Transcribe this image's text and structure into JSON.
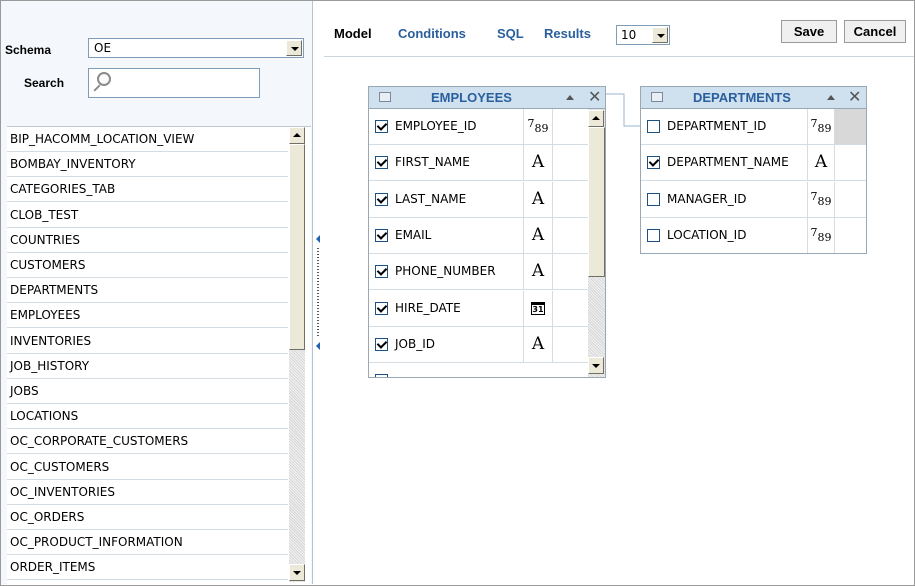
{
  "left_panel": {
    "schema_label": "Schema",
    "schema_value": "OE",
    "search_label": "Search",
    "tables": [
      "BIP_HACOMM_LOCATION_VIEW",
      "BOMBAY_INVENTORY",
      "CATEGORIES_TAB",
      "CLOB_TEST",
      "COUNTRIES",
      "CUSTOMERS",
      "DEPARTMENTS",
      "EMPLOYEES",
      "INVENTORIES",
      "JOB_HISTORY",
      "JOBS",
      "LOCATIONS",
      "OC_CORPORATE_CUSTOMERS",
      "OC_CUSTOMERS",
      "OC_INVENTORIES",
      "OC_ORDERS",
      "OC_PRODUCT_INFORMATION",
      "ORDER_ITEMS"
    ]
  },
  "toolbar": {
    "tabs": [
      "Model",
      "Conditions",
      "SQL",
      "Results"
    ],
    "rows_value": "10",
    "save_label": "Save",
    "cancel_label": "Cancel"
  },
  "employees": {
    "title": "EMPLOYEES",
    "columns": [
      {
        "name": "EMPLOYEE_ID",
        "type": "number",
        "checked": true
      },
      {
        "name": "FIRST_NAME",
        "type": "text",
        "checked": true
      },
      {
        "name": "LAST_NAME",
        "type": "text",
        "checked": true
      },
      {
        "name": "EMAIL",
        "type": "text",
        "checked": true
      },
      {
        "name": "PHONE_NUMBER",
        "type": "text",
        "checked": true
      },
      {
        "name": "HIRE_DATE",
        "type": "date",
        "checked": true
      },
      {
        "name": "JOB_ID",
        "type": "text",
        "checked": true
      }
    ]
  },
  "departments": {
    "title": "DEPARTMENTS",
    "columns": [
      {
        "name": "DEPARTMENT_ID",
        "type": "number",
        "checked": false
      },
      {
        "name": "DEPARTMENT_NAME",
        "type": "text",
        "checked": true
      },
      {
        "name": "MANAGER_ID",
        "type": "number",
        "checked": false
      },
      {
        "name": "LOCATION_ID",
        "type": "number",
        "checked": false
      }
    ]
  },
  "type_glyphs": {
    "number": "789",
    "text": "A",
    "date": "31"
  },
  "colors": {
    "link": "#2a5f9e",
    "header_bg": "#cfe0ef",
    "panel_bg": "#f4f8fc"
  }
}
